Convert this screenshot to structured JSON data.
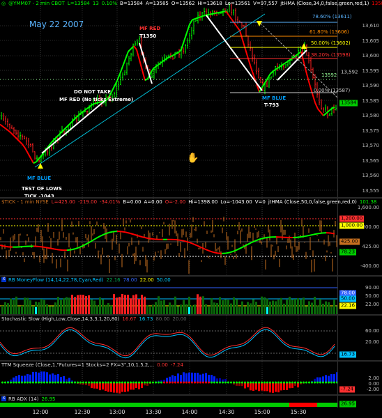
{
  "price_pane": {
    "header": {
      "symbol": "@YMM07 - 2 min  CBOT",
      "last": "L=13584",
      "change": "13",
      "pct": "0.10%",
      "bid": "B=13584",
      "ask": "A=13585",
      "open": "O=13562",
      "high": "Hi=13618",
      "low": "Lo=13561",
      "volume": "V=97,557",
      "study": "jtHMA (Close,34,0,false,green,red,1)",
      "study_value": "13584"
    },
    "date_title": "May 22 2007",
    "annotations": {
      "do_not_take": "DO NOT TAKE",
      "mf_red_no_ticks": "MF RED (No ticks Extreme)",
      "mf_red": "MF RED",
      "t1350": "T1350",
      "mf_blue_left": "MF BLUE",
      "test_of_lows": "TEST OF LOWS",
      "tick_1043": "TICK -1043",
      "mf_blue_right": "MF BLUE",
      "t793": "T-793"
    },
    "fib_labels": [
      "78.60% (13611)",
      "61.80% (13606)",
      "50.00% (13602)",
      "38.20% (13598)",
      "13592",
      "0.00% (13587)"
    ],
    "price_ticks": [
      "13,610",
      "13,605",
      "13,600",
      "13,595",
      "13,590",
      "13,585",
      "13,580",
      "13,575",
      "13,570",
      "13,565",
      "13,560",
      "13,555"
    ],
    "last_tag": "13584",
    "ref_tag": "13,592"
  },
  "tick_pane": {
    "header": {
      "title": "$TICK - 1 min  NYSE",
      "last": "L=425.00",
      "change": "-219.00",
      "pct": "-34.01%",
      "bid": "B=0.00",
      "ask": "A=0.00",
      "open": "O=-2.00",
      "high": "Hi=1398.00",
      "low": "Lo=-1043.00",
      "volume": "V=0",
      "study": "jtHMA (Close,50,0,false,green,red,0)",
      "study_value": "101.38"
    },
    "ticks": [
      "1,600.00",
      "800.00",
      "425.00",
      "-400.00"
    ],
    "tags": [
      "1,200.00",
      "1,000.00",
      "425.00",
      "78.23"
    ]
  },
  "money_flow_pane": {
    "header": {
      "title": "RB MoneyFlow (14,14,22,78,Cyan,Red)",
      "v1": "22.16",
      "v2": "78.00",
      "v3": "22.00",
      "v4": "50.00"
    },
    "ticks": [
      "90.00",
      "50.00",
      "22.00"
    ],
    "tags": [
      "78.00",
      "50.00",
      "22.16"
    ]
  },
  "stoch_pane": {
    "header": {
      "title": "Stochastic Slow (High,Low,Close,14,3,3,1,20,80)",
      "k": "16.67",
      "d": "16.73",
      "ob": "80.00",
      "os": "20.00"
    },
    "ticks": [
      "60.00",
      "20.00"
    ],
    "tags": [
      "16.73"
    ]
  },
  "squeeze_pane": {
    "header": {
      "title": "TTM Squeeze (Close,1,\"Futures=1 Stocks=2 FX=3\",10,1.5,2,...",
      "v1": "0.00",
      "v2": "-7.24"
    },
    "ticks": [
      "2.00",
      "0.00",
      "-2.00"
    ],
    "tags": [
      "-7.24"
    ]
  },
  "adx_pane": {
    "header": {
      "title": "RB ADX (14)",
      "value": "26.95"
    },
    "tags": [
      "26.95"
    ]
  },
  "time_labels": [
    "12:00",
    "12:30",
    "13:00",
    "13:30",
    "14:00",
    "14:30",
    "15:00",
    "15:30"
  ],
  "colors": {
    "bull": "#00ff00",
    "bear": "#ff0000",
    "tick": "#c87020",
    "label_blue": "#00a0ff",
    "fib_orange": "#ff8c00"
  }
}
